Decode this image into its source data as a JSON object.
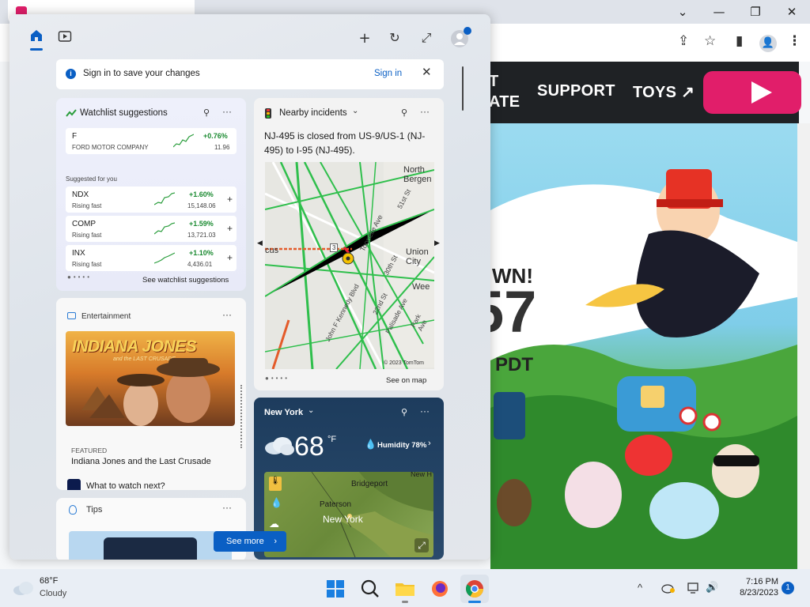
{
  "browser": {
    "win_min": "⌄",
    "win_minimize": "—",
    "win_restore": "❐",
    "win_close": "✕",
    "share_icon": "⇪",
    "star_icon": "☆",
    "sidebar_icon": "▮",
    "profile_icon": "👤",
    "menu_icon": "⋮"
  },
  "site": {
    "nav_partial_1": "T",
    "nav_partial_2": "ATE",
    "nav_support": "SUPPORT",
    "nav_toys": "TOYS ↗",
    "banner_partial": "WN!",
    "banner_number": "57",
    "banner_time": "PDT"
  },
  "panel": {
    "signin_text": "Sign in to save your changes",
    "signin_link": "Sign in",
    "watchlist": {
      "title": "Watchlist suggestions",
      "top_stock": {
        "symbol": "F",
        "name": "FORD MOTOR COMPANY",
        "change": "+0.76%",
        "price": "11.96"
      },
      "suggested_label": "Suggested for you",
      "stocks": [
        {
          "symbol": "NDX",
          "sub": "Rising fast",
          "change": "+1.60%",
          "price": "15,148.06"
        },
        {
          "symbol": "COMP",
          "sub": "Rising fast",
          "change": "+1.59%",
          "price": "13,721.03"
        },
        {
          "symbol": "INX",
          "sub": "Rising fast",
          "change": "+1.10%",
          "price": "4,436.01"
        }
      ],
      "see_link": "See watchlist suggestions"
    },
    "incidents": {
      "title": "Nearby incidents",
      "desc": "NJ-495 is closed from US-9/US-1 (NJ-495) to I-95 (NJ-495).",
      "map_labels": {
        "north_bergen": "North Bergen",
        "union_city": "Union City",
        "weehawken": "Wee",
        "secaucus": "cus",
        "tonnelle_ave": "Tonnelle Ave",
        "kennedy_blvd": "John F Kennedy Blvd",
        "palisade": "Palisade Ave",
        "st_51": "51st St",
        "st_30": "30th St",
        "st_22": "22nd St",
        "park": "Park Ave",
        "route_3": "3",
        "copyright": "© 2023 TomTom"
      },
      "see_map": "See on map"
    },
    "entertainment": {
      "label": "Entertainment",
      "poster_title": "INDIANA JONES",
      "poster_sub": "and the LAST CRUSADE",
      "featured": "FEATURED",
      "title": "Indiana Jones and the Last Crusade",
      "next": "What to watch next?"
    },
    "weather": {
      "city": "New York",
      "temp": "68",
      "unit": "°F",
      "humidity": "Humidity 78%",
      "map_labels": {
        "bridgeport": "Bridgeport",
        "paterson": "Paterson",
        "newyork": "New York",
        "new_h": "New H"
      }
    },
    "tips": {
      "label": "Tips"
    },
    "see_more": "See more"
  },
  "taskbar": {
    "weather_temp": "68°F",
    "weather_cond": "Cloudy",
    "time": "7:16 PM",
    "date": "8/23/2023",
    "notif_count": "1",
    "tray_up": "^",
    "speaker": "🔊"
  }
}
